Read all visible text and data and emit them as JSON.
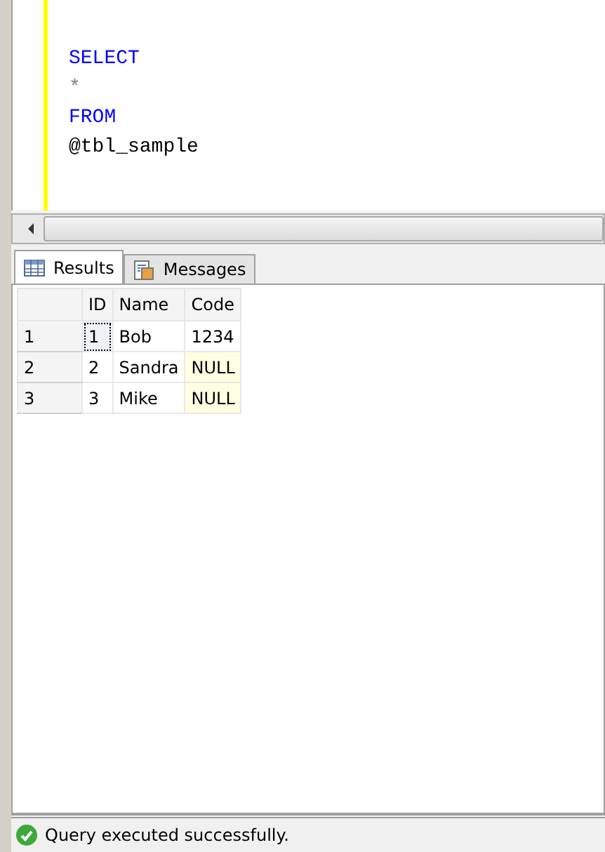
{
  "editor": {
    "lines": [
      {
        "text": "SELECT",
        "kind": "keyword"
      },
      {
        "text": "*",
        "kind": "operator"
      },
      {
        "text": "FROM",
        "kind": "keyword"
      },
      {
        "text": "@tbl_sample",
        "kind": "identifier"
      }
    ]
  },
  "tabs": [
    {
      "label": "Results",
      "kind": "grid",
      "selected": true
    },
    {
      "label": "Messages",
      "kind": "messages",
      "selected": false
    }
  ],
  "grid": {
    "columns": [
      "ID",
      "Name",
      "Code"
    ],
    "rows": [
      {
        "number": "1",
        "cells": [
          {
            "text": "1",
            "focused": true,
            "null": false
          },
          {
            "text": "Bob",
            "focused": false,
            "null": false
          },
          {
            "text": "1234",
            "focused": false,
            "null": false
          }
        ]
      },
      {
        "number": "2",
        "cells": [
          {
            "text": "2",
            "focused": false,
            "null": false
          },
          {
            "text": "Sandra",
            "focused": false,
            "null": false
          },
          {
            "text": "NULL",
            "focused": false,
            "null": true
          }
        ]
      },
      {
        "number": "3",
        "cells": [
          {
            "text": "3",
            "focused": false,
            "null": false
          },
          {
            "text": "Mike",
            "focused": false,
            "null": false
          },
          {
            "text": "NULL",
            "focused": false,
            "null": true
          }
        ]
      }
    ]
  },
  "status_bar": {
    "text": "Query executed successfully."
  }
}
